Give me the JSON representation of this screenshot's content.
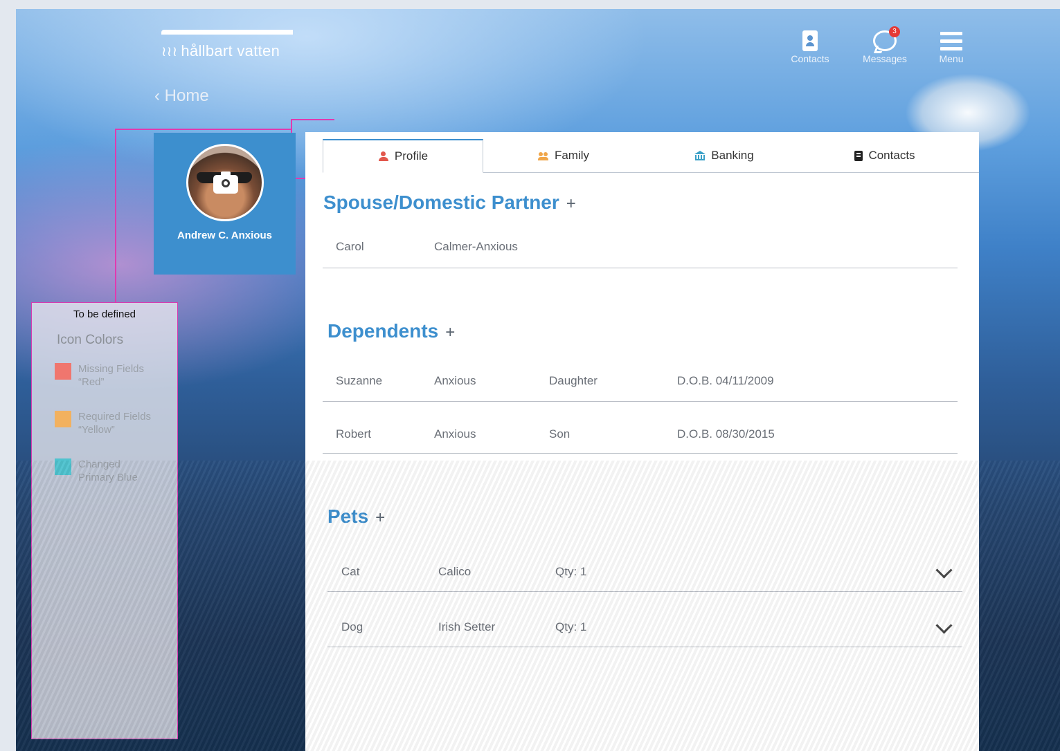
{
  "brand": {
    "logo_text": "hållbart vatten",
    "logo_symbol": "≀≀≀"
  },
  "nav": {
    "contacts_label": "Contacts",
    "messages_label": "Messages",
    "messages_badge": "3",
    "menu_label": "Menu"
  },
  "breadcrumb": {
    "back_glyph": "‹",
    "label": "Home"
  },
  "profile": {
    "name": "Andrew C. Anxious"
  },
  "legend": {
    "note": "To be defined",
    "title": "Icon Colors",
    "items": [
      {
        "line1": "Missing Fields",
        "line2": "“Red”",
        "color": "#f0766e"
      },
      {
        "line1": "Required Fields",
        "line2": "“Yellow”",
        "color": "#f2b15f"
      },
      {
        "line1": "Changed",
        "line2": "Primary Blue",
        "color": "#4fc3cf"
      }
    ]
  },
  "tabs": [
    {
      "label": "Profile",
      "icon": "person-icon"
    },
    {
      "label": "Family",
      "icon": "family-icon"
    },
    {
      "label": "Banking",
      "icon": "bank-icon"
    },
    {
      "label": "Contacts",
      "icon": "address-book-icon"
    }
  ],
  "sections": {
    "spouse": {
      "title": "Spouse/Domestic Partner",
      "add": "+",
      "rows": [
        {
          "first": "Carol",
          "last": "Calmer-Anxious"
        }
      ]
    },
    "dependents": {
      "title": "Dependents",
      "add": "+",
      "rows": [
        {
          "first": "Suzanne",
          "last": "Anxious",
          "relation": "Daughter",
          "dob": "D.O.B. 04/11/2009"
        },
        {
          "first": "Robert",
          "last": "Anxious",
          "relation": "Son",
          "dob": "D.O.B. 08/30/2015"
        }
      ]
    },
    "pets": {
      "title": "Pets",
      "add": "+",
      "rows": [
        {
          "type": "Cat",
          "breed": "Calico",
          "qty": "Qty: 1"
        },
        {
          "type": "Dog",
          "breed": "Irish Setter",
          "qty": "Qty: 1"
        }
      ]
    }
  },
  "colors": {
    "primary": "#3d8fce",
    "annotation": "#e03ab0"
  }
}
